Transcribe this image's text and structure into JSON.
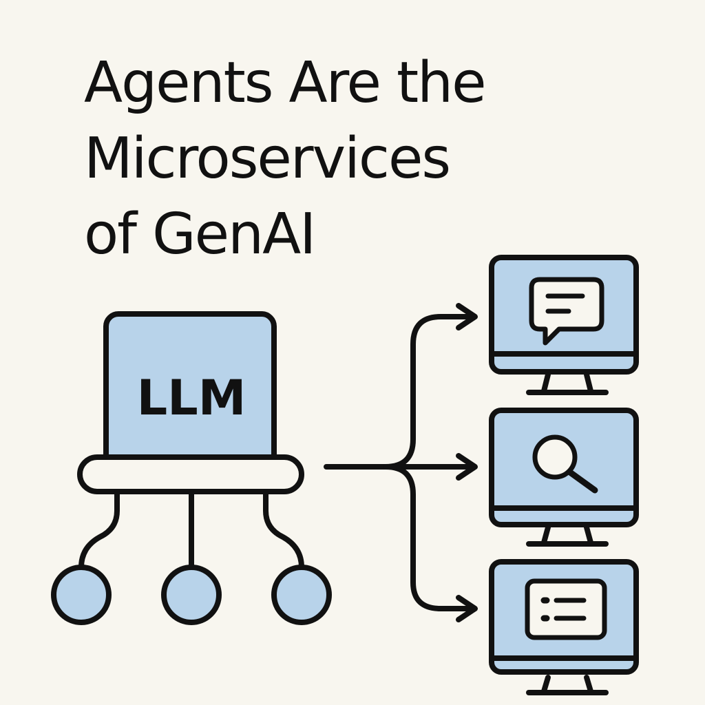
{
  "title": {
    "line1": "Agents Are the",
    "line2": "Microservices",
    "line3": "of GenAI"
  },
  "diagram": {
    "llm_label": "LLM",
    "agents": [
      {
        "icon": "chat-bubble-icon"
      },
      {
        "icon": "search-icon"
      },
      {
        "icon": "list-icon"
      }
    ]
  },
  "colors": {
    "background": "#f8f6ef",
    "fill": "#b8d3ea",
    "stroke": "#111111"
  }
}
